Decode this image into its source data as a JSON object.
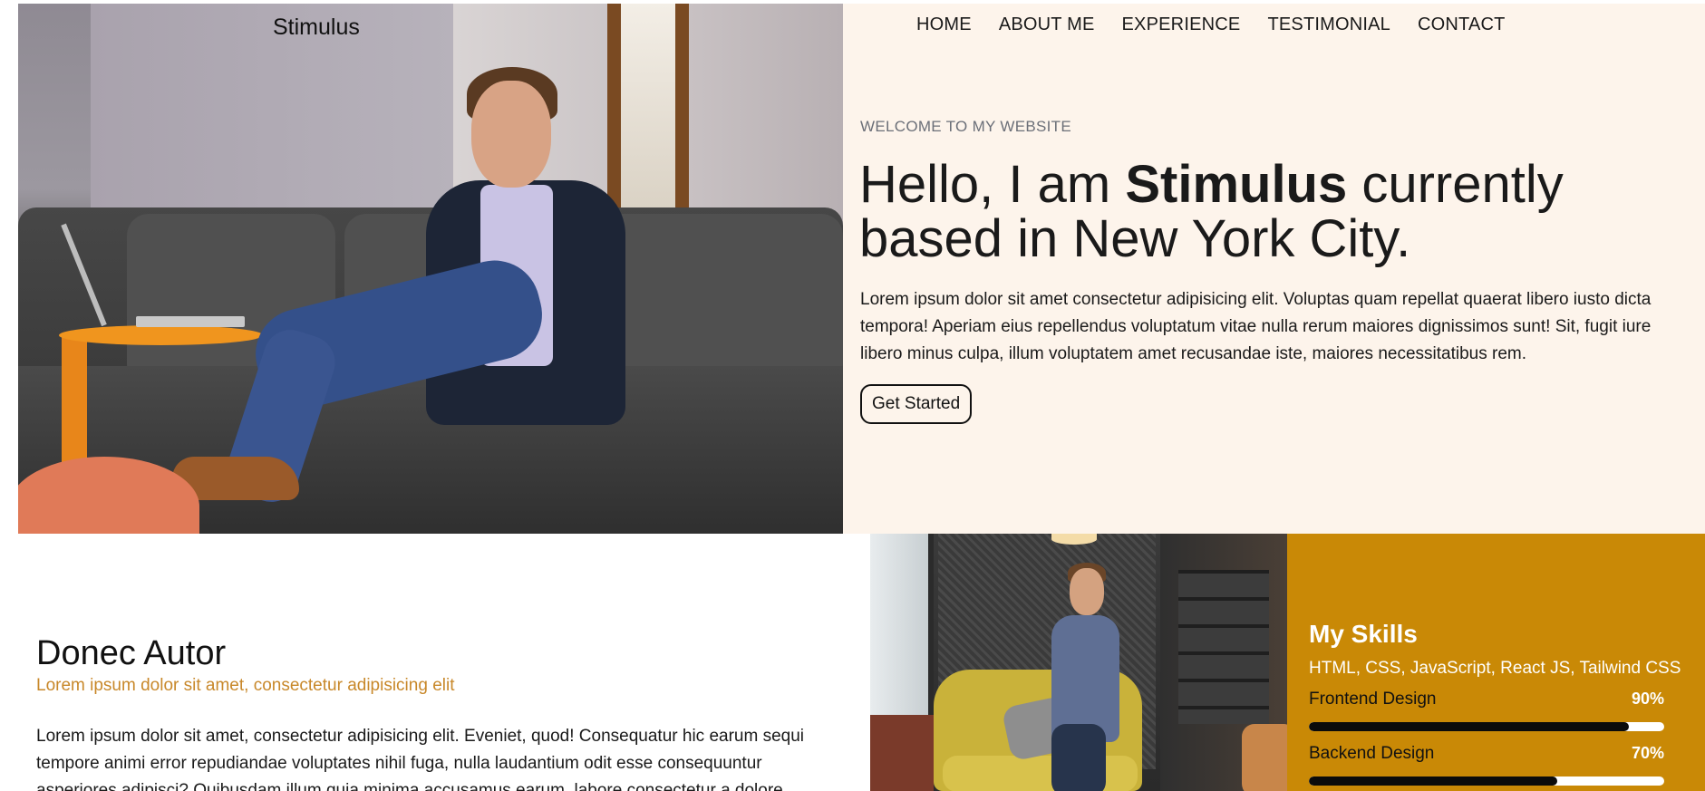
{
  "brand": {
    "name": "Stimulus"
  },
  "nav": {
    "items": [
      {
        "label": "HOME"
      },
      {
        "label": "ABOUT ME"
      },
      {
        "label": "EXPERIENCE"
      },
      {
        "label": "TESTIMONIAL"
      },
      {
        "label": "CONTACT"
      }
    ]
  },
  "hero": {
    "eyebrow": "WELCOME TO MY WEBSITE",
    "headline_pre": "Hello, I am ",
    "headline_name": "Stimulus",
    "headline_post": " currently based in New York City.",
    "intro": "Lorem ipsum dolor sit amet consectetur adipisicing elit. Voluptas quam repellat quaerat libero iusto dicta tempora! Aperiam eius repellendus voluptatum vitae nulla rerum maiores dignissimos sunt! Sit, fugit iure libero minus culpa, illum voluptatem amet recusandae iste, maiores necessitatibus rem.",
    "cta_label": "Get Started"
  },
  "about": {
    "title": "Donec Autor",
    "subtitle": "Lorem ipsum dolor sit amet, consectetur adipisicing elit",
    "body": "Lorem ipsum dolor sit amet, consectetur adipisicing elit. Eveniet, quod! Consequatur hic earum sequi tempore animi error repudiandae voluptates nihil fuga, nulla laudantium odit esse consequuntur asperiores adipisci? Quibusdam illum quia minima accusamus earum, labore consectetur a dolore"
  },
  "skills": {
    "title": "My Skills",
    "list": "HTML, CSS, JavaScript, React JS, Tailwind CSS",
    "items": [
      {
        "name": "Frontend Design",
        "percent_label": "90%",
        "percent": 90
      },
      {
        "name": "Backend Design",
        "percent_label": "70%",
        "percent": 70
      }
    ]
  },
  "colors": {
    "hero_panel_bg": "#fdf4eb",
    "accent_gold": "#c98906",
    "subtitle_orange": "#c8882a",
    "progress_fill": "#0b0b0b"
  },
  "icons": {
    "hero_image": "man-on-sofa-with-laptop-photo",
    "about_image": "man-reading-in-office-chair-photo"
  }
}
